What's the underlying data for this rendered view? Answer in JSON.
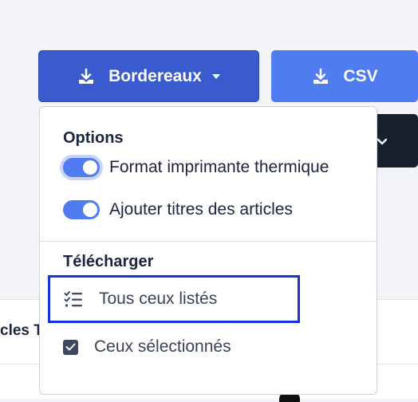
{
  "toolbar": {
    "bordereaux_label": "Bordereaux",
    "csv_label": "CSV"
  },
  "background": {
    "partial_column_text": "cles T"
  },
  "dropdown": {
    "options_title": "Options",
    "toggles": [
      {
        "label": "Format imprimante thermique",
        "on": true
      },
      {
        "label": "Ajouter titres des articles",
        "on": true
      }
    ],
    "download_title": "Télécharger",
    "items": [
      {
        "label": "Tous ceux listés",
        "icon": "list-check-icon"
      },
      {
        "label": "Ceux sélectionnés",
        "icon": "checkbox-icon"
      }
    ]
  },
  "colors": {
    "primary": "#3a5bcd",
    "secondary": "#4f7cf0",
    "highlight": "#1533d6"
  }
}
